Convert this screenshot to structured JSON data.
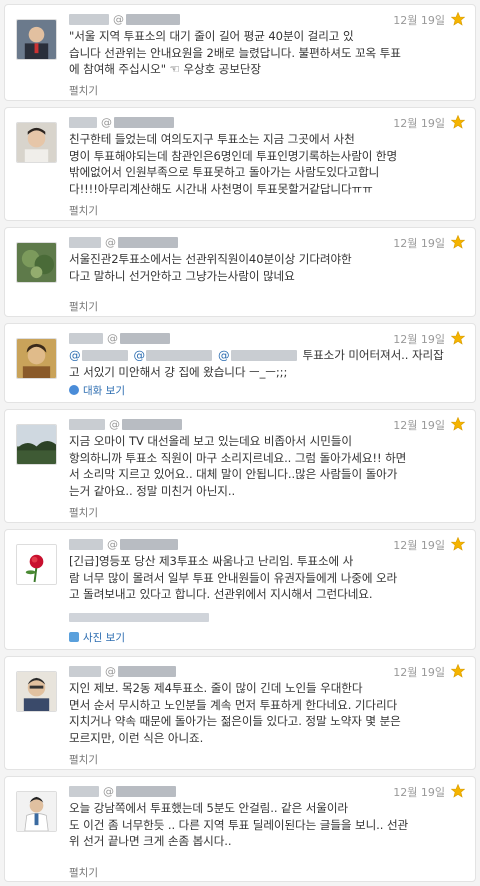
{
  "feed": {
    "tweets": [
      {
        "time": "12월 19일",
        "lines": [
          "\"서울 지역 투표소의 대기 줄이 길어 평균 40분이 걸리고 있",
          "습니다 선관위는 안내요원을 2배로 늘렸답니다. 불편하셔도 꼬옥 투표",
          "에 참여해 주십시오\" ☜ 우상호 공보단장"
        ],
        "expand": "펼치기"
      },
      {
        "time": "12월 19일",
        "lines": [
          "친구한테 들었는데 여의도지구 투표소는 지금 그곳에서 사천",
          "명이 투표해야되는데 참관인은6명인데 투표인명기록하는사람이 한명",
          "밖에없어서 인원부족으로 투표못하고 돌아가는 사람도있다고합니",
          "다!!!!아무리계산해도 시간내 사천명이 투표못할거같답니다ㅠㅠ"
        ],
        "expand": "펼치기"
      },
      {
        "time": "12월 19일",
        "lines": [
          "서울진관2투표소에서는 선관위직원이40분이상 기다려야한",
          "다고 말하니 선거안하고 그냥가는사람이 많네요"
        ],
        "expand": "펼치기"
      },
      {
        "time": "12월 19일",
        "lines": [
          "투표소가 미어터져서.. 자리잡",
          "고 서있기 미안해서 걍 집에 왔습니다 ㅡ_ㅡ;;;"
        ],
        "action": "대화 보기"
      },
      {
        "time": "12월 19일",
        "lines": [
          "지금 오마이 TV 대선올레 보고 있는데요 비좁아서 시민들이",
          "항의하니까 투표소 직원이 마구 소리지르네요.. 그럼 돌아가세요!! 하면",
          "서 소리막 지르고 있어요.. 대체 말이 안됩니다..많은 사람들이 돌아가",
          "는거 같아요.. 정말 미친거 아닌지.."
        ],
        "expand": "펼치기"
      },
      {
        "time": "12월 19일",
        "lines": [
          "[긴급]영등포 당산 제3투표소 싸움나고 난리임. 투표소에 사",
          "람 너무 많이 몰려서 일부 투표 안내원들이 유권자들에게 나중에 오라",
          "고 돌려보내고 있다고 합니다. 선관위에서 지시해서 그런다네요."
        ],
        "action": "사진 보기"
      },
      {
        "time": "12월 19일",
        "lines": [
          "지인 제보. 목2동 제4투표소. 줄이 많이 긴데 노인들 우대한다",
          "면서 순서 무시하고 노인분들 계속 먼저 투표하게 한다네요. 기다리다",
          "지치거나 약속 때문에 돌아가는 젊은이들 있다고. 정말 노약자 몇 분은",
          "모르지만, 이런 식은 아니죠."
        ],
        "expand": "펼치기"
      },
      {
        "time": "12월 19일",
        "lines": [
          "오늘 강남쪽에서 투표했는데 5분도 안걸림.. 같은 서울이라",
          "도 이건 좀 너무한듯 .. 다른 지역 투표 딜레이된다는 글들을 보니.. 선관",
          "위 선거 끝나면 크게 손좀 봅시다.."
        ],
        "expand": "펼치기"
      }
    ]
  },
  "colors": {
    "accent": "#f5b400",
    "link": "#2b6cb0",
    "muted": "#999999"
  }
}
